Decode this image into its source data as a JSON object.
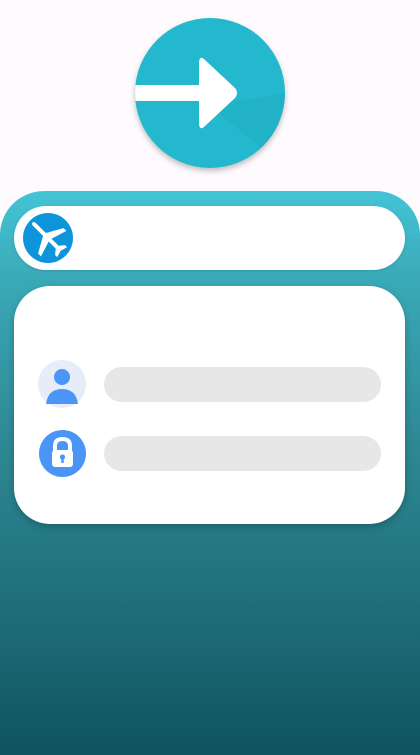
{
  "enter_button": {
    "icon": "arrow-right-icon",
    "color": "#24b8cf"
  },
  "panel": {
    "gradient_top": "#43c4d6",
    "gradient_bottom": "#0f5360"
  },
  "airline_selector": {
    "icon": "airplane-icon",
    "selected_airline": "",
    "icon_color": "#0e94db"
  },
  "login": {
    "username": {
      "icon": "user-icon",
      "value": "",
      "placeholder": ""
    },
    "password": {
      "icon": "lock-icon",
      "value": "",
      "placeholder": ""
    },
    "accent": "#4a95f6"
  }
}
